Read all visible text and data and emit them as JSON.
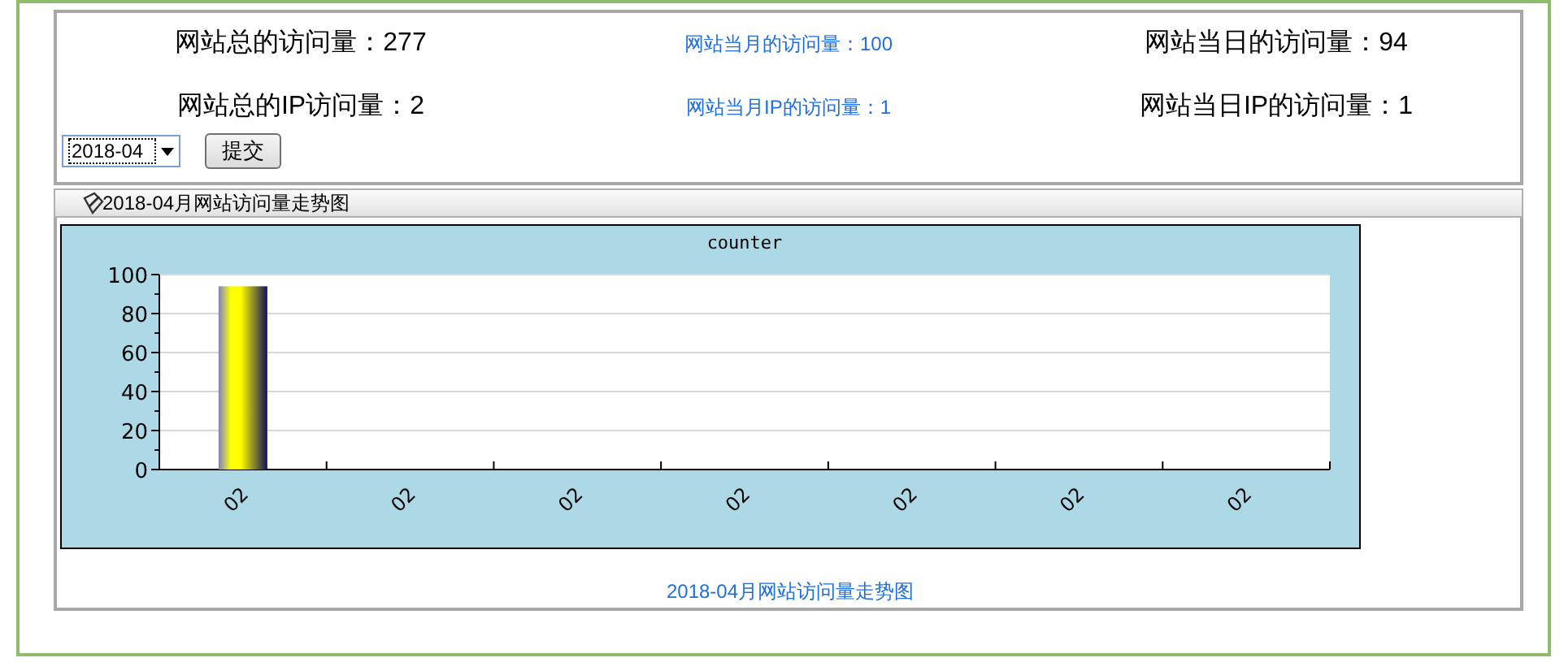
{
  "stats": [
    {
      "label": "网站总的访问量：277",
      "kind": "large"
    },
    {
      "label": "网站当月的访问量：100",
      "kind": "small"
    },
    {
      "label": "网站当日的访问量：94",
      "kind": "large"
    },
    {
      "label": "网站总的IP访问量：2",
      "kind": "large"
    },
    {
      "label": "网站当月IP的访问量：1",
      "kind": "small"
    },
    {
      "label": "网站当日IP的访问量：1",
      "kind": "large"
    }
  ],
  "month_select": {
    "value": "2018-04"
  },
  "submit_button": "提交",
  "panel_title": "2018-04月网站访问量走势图",
  "chart": {
    "chart_data": {
      "type": "bar",
      "title": "counter",
      "categories": [
        "02",
        "02",
        "02",
        "02",
        "02",
        "02",
        "02"
      ],
      "values": [
        94,
        0,
        0,
        0,
        0,
        0,
        0
      ],
      "ylim": [
        0,
        100
      ],
      "yticks": [
        0,
        20,
        40,
        60,
        80,
        100
      ],
      "grid": true
    }
  },
  "caption": "2018-04月网站访问量走势图"
}
